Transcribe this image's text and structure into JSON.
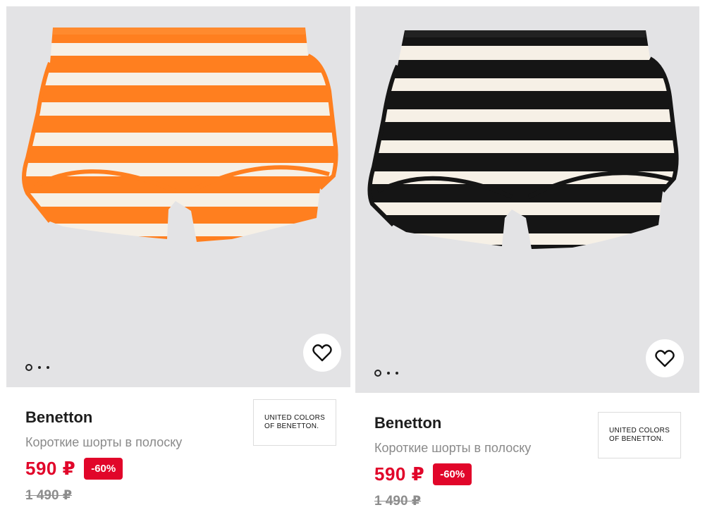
{
  "colors": {
    "price_red": "#e1062a",
    "photo_bg": "#e3e3e5",
    "orange_stripe": "#ff7f1f",
    "black_stripe": "#151515",
    "cream_stripe": "#f6f0e6"
  },
  "products": [
    {
      "brand": "Benetton",
      "title": "Короткие шорты в полоску",
      "price": "590 ₽",
      "discount": "-60%",
      "old_price": "1 490 ₽",
      "logo_line1": "UNITED COLORS",
      "logo_line2": "OF BENETTON.",
      "stripe_color": "orange",
      "favorite_icon": "heart-outline-icon",
      "carousel_dots": 3,
      "active_dot": 1
    },
    {
      "brand": "Benetton",
      "title": "Короткие шорты в полоску",
      "price": "590 ₽",
      "discount": "-60%",
      "old_price": "1 490 ₽",
      "logo_line1": "UNITED COLORS",
      "logo_line2": "OF BENETTON.",
      "stripe_color": "black",
      "favorite_icon": "heart-outline-icon",
      "carousel_dots": 3,
      "active_dot": 1
    }
  ]
}
